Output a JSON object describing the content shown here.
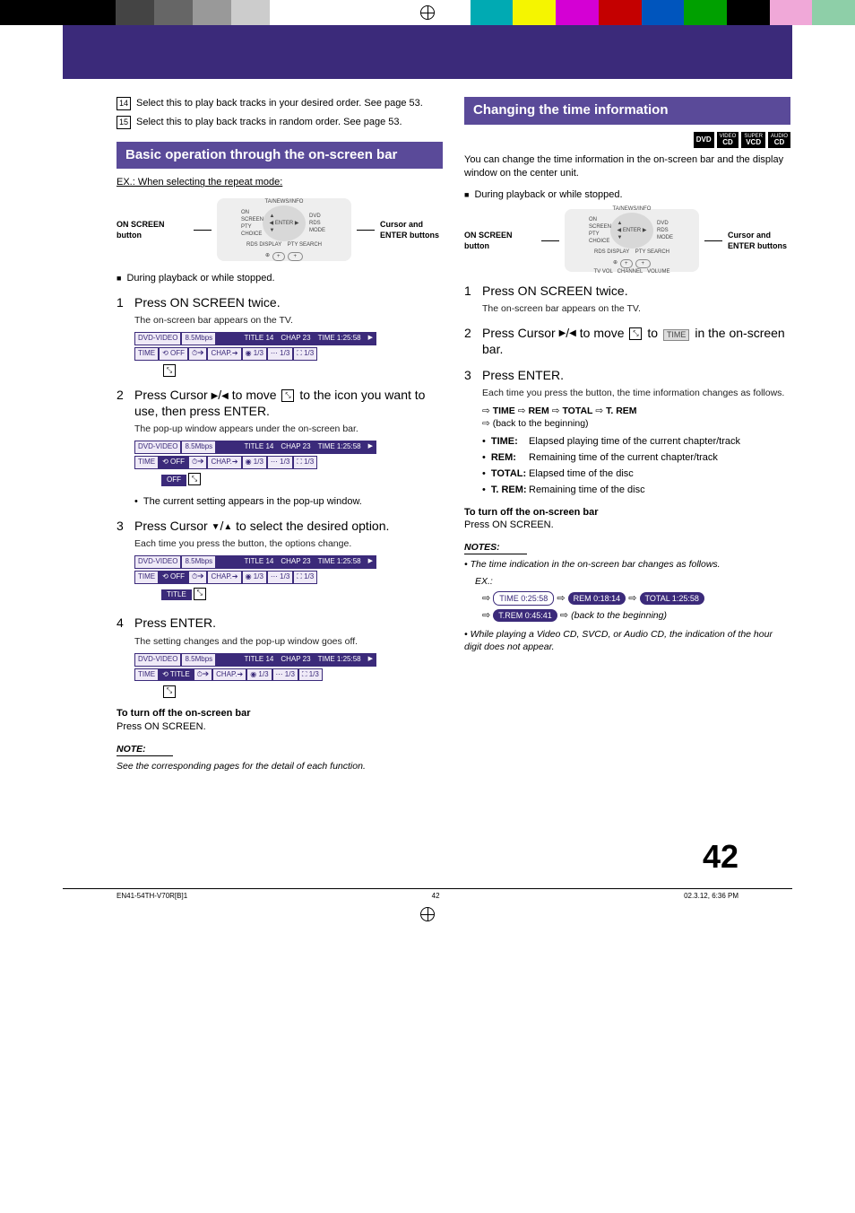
{
  "topbar": {
    "colors_left": [
      "#000",
      "#000",
      "#000",
      "#000",
      "#555",
      "#888",
      "#bbb",
      "#fff",
      "#fff",
      "#fff"
    ],
    "colors_right": [
      "#00a0a0",
      "#e6e600",
      "#d000d0",
      "#c00000",
      "#0060c0",
      "#00a000",
      "#000",
      "#e09fcf",
      "#88ccaa"
    ]
  },
  "numbered": {
    "14": "Select this to play back tracks in your desired order. See page 53.",
    "15": "Select this to play back tracks in random order. See page 53."
  },
  "left": {
    "sectionTitle": "Basic operation through the on-screen bar",
    "example": "EX.: When selecting the repeat mode:",
    "diagLeft": "ON SCREEN button",
    "diagRight": "Cursor and ENTER buttons",
    "bullet1": "During playback or while stopped.",
    "s1_head": "Press ON SCREEN twice.",
    "s1_sub": "The on-screen bar appears on the TV.",
    "s2_head_a": "Press Cursor ",
    "s2_head_b": " to move ",
    "s2_head_c": " to the icon you want to use, then press ENTER.",
    "s2_sub": "The pop-up window appears under the on-screen bar.",
    "pop_off": "OFF",
    "s2_bullet": "The current setting appears in the pop-up window.",
    "s3_head_a": "Press Cursor ",
    "s3_head_b": " to select the desired option.",
    "s3_sub": "Each time you press the button, the options change.",
    "pop_title": "TITLE",
    "s4_head": "Press ENTER.",
    "s4_sub": "The setting changes and the pop-up window goes off.",
    "off_heading": "To turn off the on-screen bar",
    "off_body": "Press ON SCREEN.",
    "note_label": "NOTE:",
    "note_body": "See the corresponding pages for the detail of each function."
  },
  "right": {
    "sectionTitle": "Changing the time information",
    "badges": [
      {
        "top": "",
        "main": "DVD"
      },
      {
        "top": "VIDEO",
        "main": "CD"
      },
      {
        "top": "SUPER",
        "main": "VCD"
      },
      {
        "top": "AUDIO",
        "main": "CD"
      }
    ],
    "intro": "You can change the time information in the on-screen bar and the display window on the center unit.",
    "bullet1": "During playback or while stopped.",
    "diagLeft": "ON SCREEN button",
    "diagRight": "Cursor and ENTER buttons",
    "s1_head": "Press ON SCREEN twice.",
    "s1_sub": "The on-screen bar appears on the TV.",
    "s2_head_a": "Press Cursor ",
    "s2_head_b": " to move ",
    "s2_head_c": " to ",
    "s2_time_tag": "TIME",
    "s2_head_d": " in the on-screen bar.",
    "s3_head": "Press ENTER.",
    "s3_sub": "Each time you press the button, the time information changes as follows.",
    "seq": [
      "TIME",
      "REM",
      "TOTAL",
      "T. REM"
    ],
    "seq_back": "(back to the beginning)",
    "defs": [
      {
        "k": "TIME:",
        "v": "Elapsed playing time of the current chapter/track"
      },
      {
        "k": "REM:",
        "v": "Remaining time of the current chapter/track"
      },
      {
        "k": "TOTAL:",
        "v": "Elapsed time of the disc"
      },
      {
        "k": "T. REM:",
        "v": "Remaining time of the disc"
      }
    ],
    "off_heading": "To turn off the on-screen bar",
    "off_body": "Press ON SCREEN.",
    "notes_label": "NOTES:",
    "note1": "The time indication in the on-screen bar changes as follows.",
    "note_ex": "EX.:",
    "chips1": [
      "TIME  0:25:58",
      "REM  0:18:14",
      "TOTAL 1:25:58"
    ],
    "chips2": "T.REM  0:45:41",
    "chips2_tail": " (back to the beginning)",
    "note2": "While playing a Video CD, SVCD, or Audio CD, the indication of the hour digit does not appear."
  },
  "osd": {
    "label": "DVD-VIDEO",
    "rate": "8.5Mbps",
    "title": "TITLE 14",
    "chap": "CHAP 23",
    "time": "TIME 1:25:58",
    "row2_time": "TIME",
    "row2_off": "OFF",
    "row2_chap": "CHAP.",
    "row2_13a": "1/3",
    "row2_13b": "1/3",
    "row2_13c": "1/3",
    "row2_title_mode": "TITLE"
  },
  "pageNumber": "42",
  "footer": {
    "left": "EN41-54TH-V70R[B]1",
    "mid": "42",
    "right": "02.3.12, 6:36 PM"
  }
}
